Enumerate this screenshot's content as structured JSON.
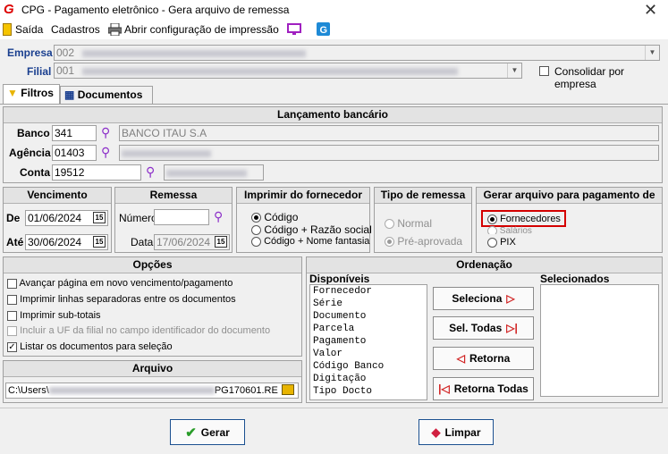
{
  "window": {
    "title": "CPG - Pagamento eletrônico - Gera arquivo de remessa",
    "close": "✕"
  },
  "menu": {
    "saida": "Saída",
    "cadastros": "Cadastros",
    "print_config": "Abrir configuração de impressão"
  },
  "header": {
    "empresa_label": "Empresa",
    "empresa_value": "002",
    "filial_label": "Filial",
    "filial_value": "001",
    "consolidar_label": "Consolidar por empresa",
    "consolidar_checked": false
  },
  "tabs": {
    "filtros": "Filtros",
    "documentos": "Documentos"
  },
  "lancamento": {
    "title": "Lançamento bancário",
    "banco_label": "Banco",
    "banco_code": "341",
    "banco_name": "BANCO ITAU S.A",
    "agencia_label": "Agência",
    "agencia_code": "01403",
    "conta_label": "Conta",
    "conta_code": "19512"
  },
  "vencimento": {
    "title": "Vencimento",
    "de_label": "De",
    "de_value": "01/06/2024",
    "ate_label": "Até",
    "ate_value": "30/06/2024"
  },
  "remessa": {
    "title": "Remessa",
    "numero_label": "Número",
    "numero_value": "",
    "data_label": "Data",
    "data_value": "17/06/2024"
  },
  "imprimir": {
    "title": "Imprimir do fornecedor",
    "opt1": "Código",
    "opt2": "Código + Razão social",
    "opt3": "Código + Nome fantasia",
    "selected": "Código"
  },
  "tipo_remessa": {
    "title": "Tipo de remessa",
    "opt1": "Normal",
    "opt2": "Pré-aprovada",
    "selected": "Pré-aprovada"
  },
  "gerar_arquivo": {
    "title": "Gerar arquivo para pagamento de",
    "opt1": "Fornecedores",
    "opt2": "Salários",
    "opt3": "PIX",
    "selected": "Fornecedores",
    "highlight_color": "#d40000"
  },
  "opcoes": {
    "title": "Opções",
    "items": [
      {
        "label": "Avançar página em novo vencimento/pagamento",
        "checked": false,
        "enabled": true
      },
      {
        "label": "Imprimir linhas separadoras entre os documentos",
        "checked": false,
        "enabled": true
      },
      {
        "label": "Imprimir sub-totais",
        "checked": false,
        "enabled": true
      },
      {
        "label": "Incluir a UF da filial no campo identificador do documento",
        "checked": false,
        "enabled": false
      },
      {
        "label": "Listar os documentos para seleção",
        "checked": true,
        "enabled": true
      }
    ]
  },
  "arquivo": {
    "title": "Arquivo",
    "path_start": "C:\\Users\\",
    "path_end": "PG170601.RE"
  },
  "ordenacao": {
    "title": "Ordenação",
    "disponiveis_label": "Disponíveis",
    "selecionados_label": "Selecionados",
    "disponiveis": [
      "Fornecedor",
      "Série",
      "Documento",
      "Parcela",
      "Pagamento",
      "Valor",
      "Código Banco",
      "Digitação",
      "Tipo Docto"
    ],
    "btn_seleciona": "Seleciona",
    "btn_sel_todas": "Sel. Todas",
    "btn_retorna": "Retorna",
    "btn_retorna_todas": "Retorna Todas"
  },
  "footer": {
    "gerar": "Gerar",
    "limpar": "Limpar"
  },
  "colors": {
    "accent_blue": "#1a3f8f",
    "arrow_red": "#d02020",
    "check_green": "#2a9d2a"
  }
}
